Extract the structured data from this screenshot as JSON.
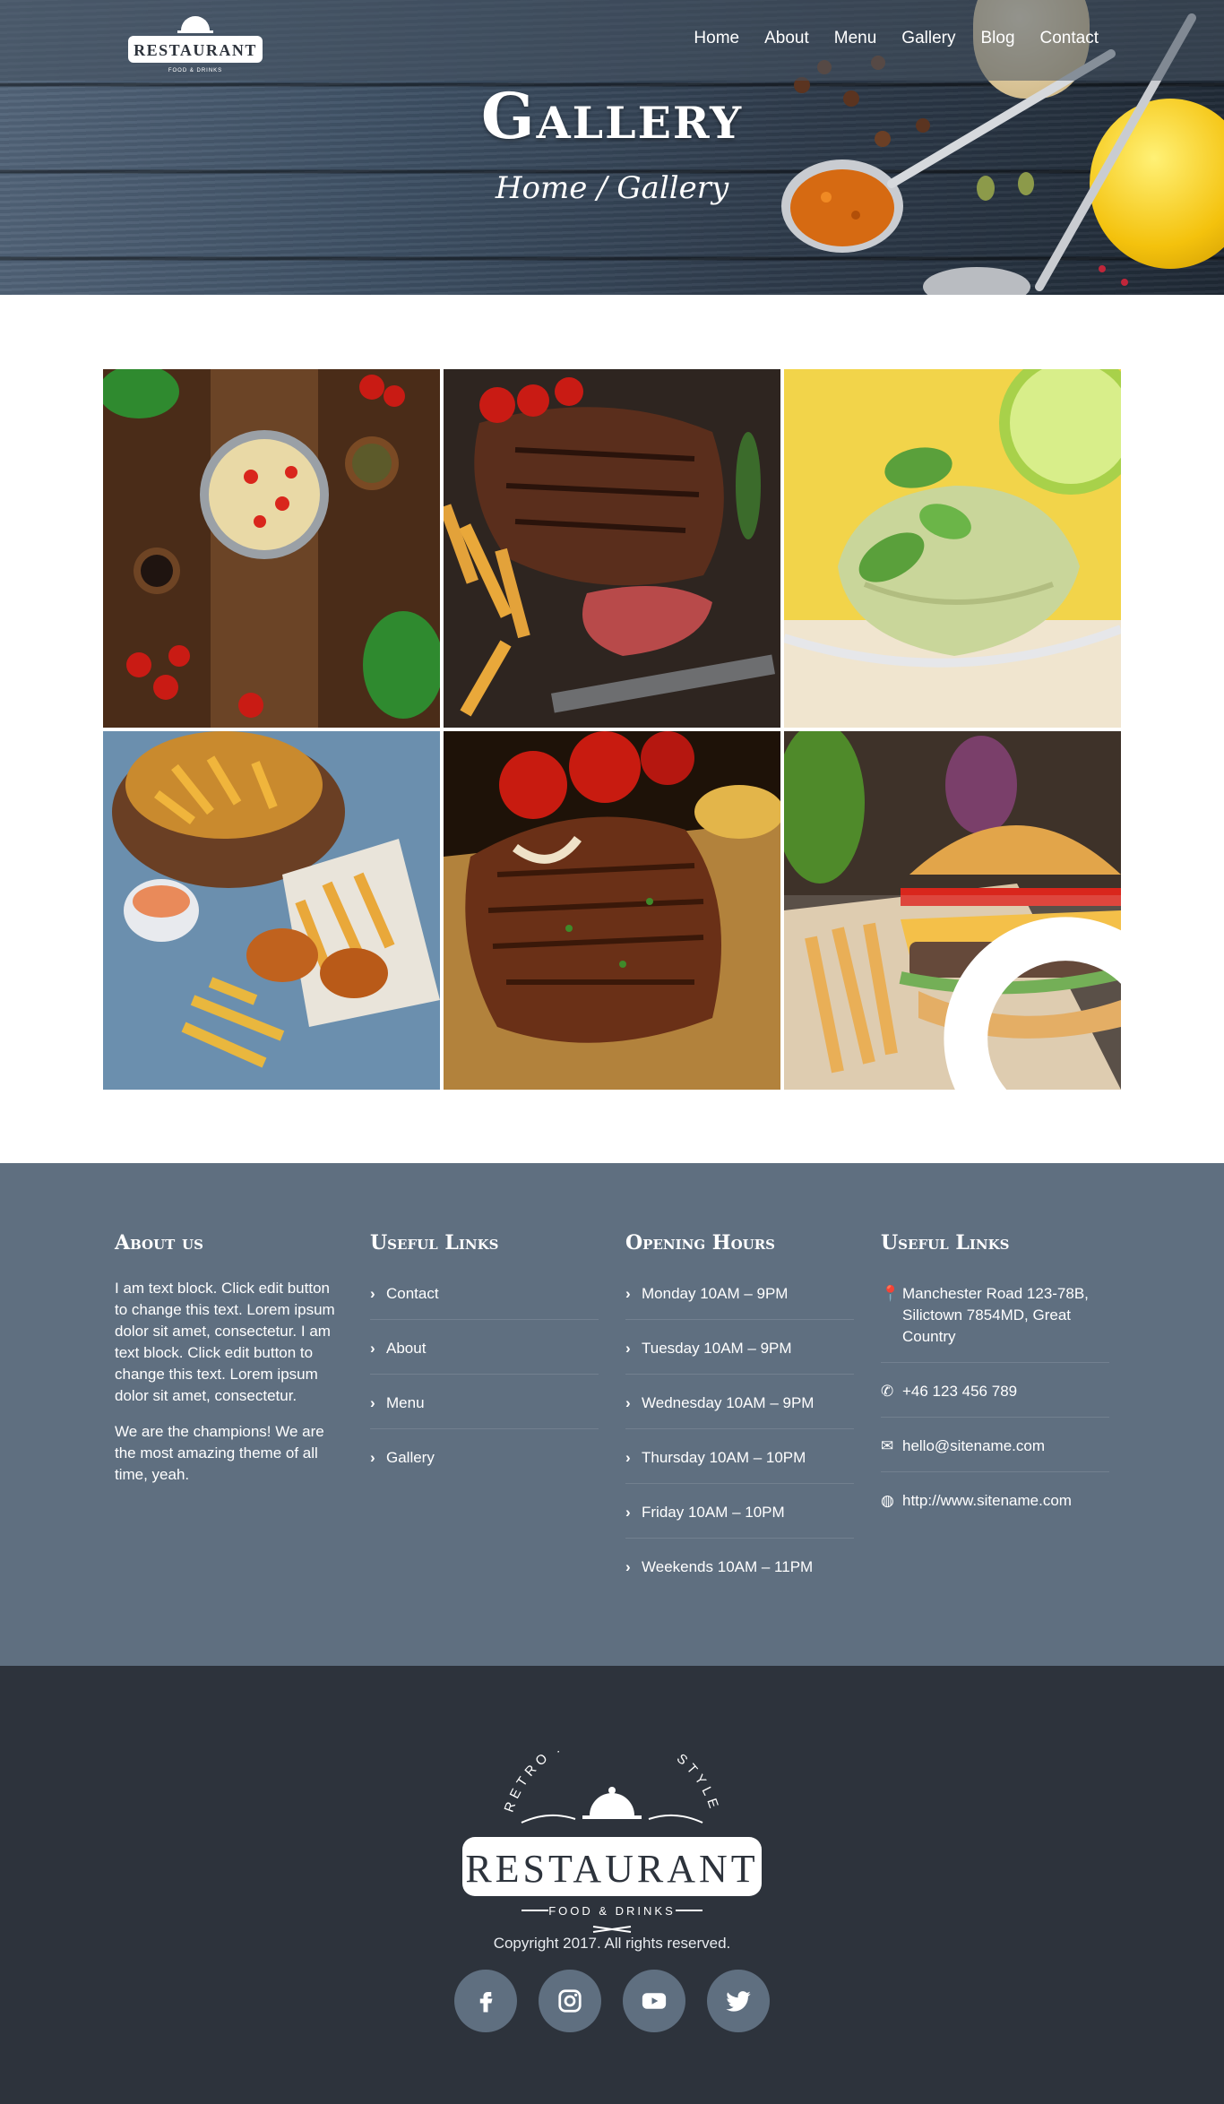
{
  "header": {
    "logo_text": "RESTAURANT",
    "logo_arc_text": "RETRO AUTHENTIC STYLE",
    "logo_sub_text": "FOOD & DRINKS",
    "nav": [
      "Home",
      "About",
      "Menu",
      "Gallery",
      "Blog",
      "Contact"
    ],
    "title": "Gallery",
    "breadcrumb": "Home / Gallery"
  },
  "gallery": {
    "images": [
      "pasta-dish",
      "grilled-steak",
      "ice-cream",
      "fried-chicken-fries",
      "t-bone-steak",
      "burger-fries"
    ],
    "hover_icon": "search-icon"
  },
  "footer": {
    "about": {
      "heading": "About us",
      "paragraphs": [
        "I am text block. Click edit button to change this text. Lorem ipsum dolor sit amet, consectetur. I am text block. Click edit button to change this text. Lorem ipsum dolor sit amet, consectetur.",
        "We are the champions! We are the most amazing theme of all time, yeah."
      ]
    },
    "links": {
      "heading": "Useful Links",
      "items": [
        "Contact",
        "About",
        "Menu",
        "Gallery"
      ]
    },
    "hours": {
      "heading": "Opening Hours",
      "items": [
        "Monday 10AM – 9PM",
        "Tuesday 10AM – 9PM",
        "Wednesday 10AM – 9PM",
        "Thursday 10AM – 10PM",
        "Friday 10AM – 10PM",
        "Weekends 10AM – 11PM"
      ]
    },
    "contact": {
      "heading": "Useful Links",
      "address": "Manchester Road 123-78B, Silictown 7854MD, Great Country",
      "phone": "+46 123 456 789",
      "email": "hello@sitename.com",
      "website": "http://www.sitename.com"
    },
    "copyright": "Copyright 2017. All rights reserved.",
    "socials": [
      "facebook-icon",
      "instagram-icon",
      "youtube-icon",
      "twitter-icon"
    ]
  },
  "colors": {
    "footer_top": "#5f6f80",
    "footer_bottom": "#2d333c",
    "social_bg": "#5f6f80"
  }
}
